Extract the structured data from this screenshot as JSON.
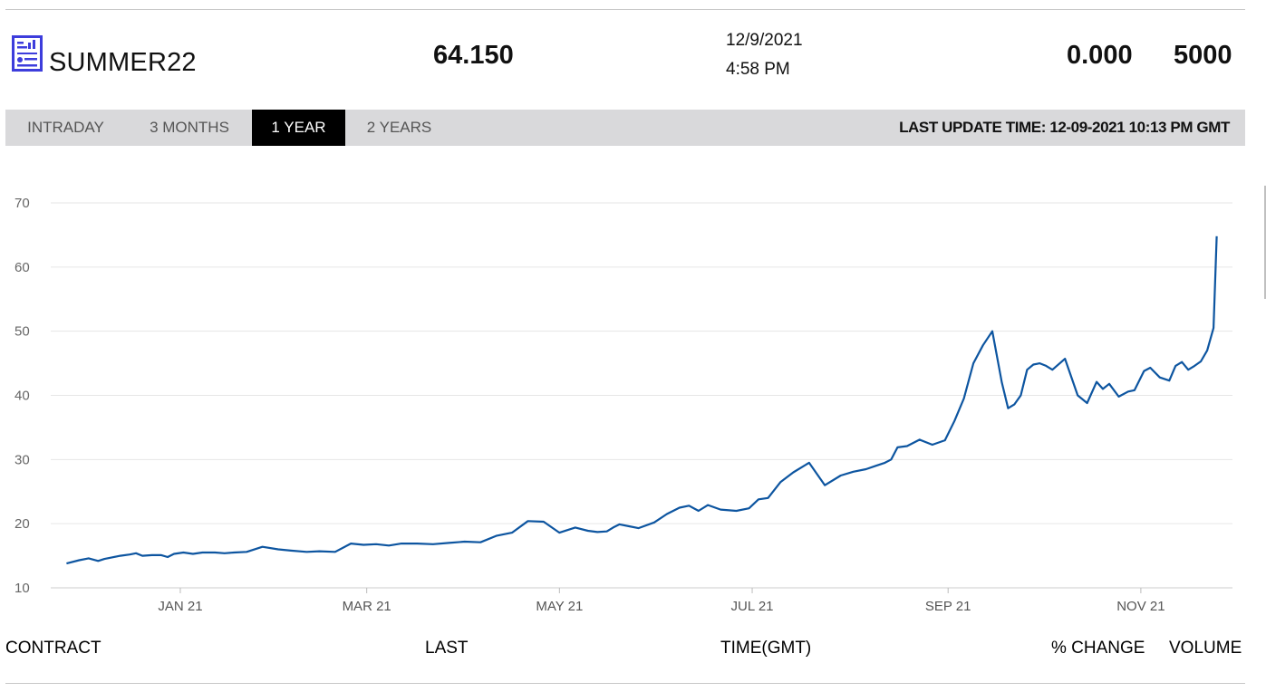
{
  "quote": {
    "contract": "SUMMER22",
    "last": "64.150",
    "date": "12/9/2021",
    "time": "4:58 PM",
    "pct_change": "0.000",
    "volume": "5000"
  },
  "tabs": [
    {
      "label": "INTRADAY",
      "active": false
    },
    {
      "label": "3 MONTHS",
      "active": false
    },
    {
      "label": "1 YEAR",
      "active": true
    },
    {
      "label": "2 YEARS",
      "active": false
    }
  ],
  "last_update": "LAST UPDATE TIME: 12-09-2021 10:13 PM GMT",
  "columns": {
    "contract": "CONTRACT",
    "last": "LAST",
    "time": "TIME(GMT)",
    "pct_change": "% CHANGE",
    "volume": "VOLUME"
  },
  "colors": {
    "line": "#0d55a0",
    "active_tab_bg": "#000000",
    "tabbar_bg": "#d9d9db",
    "icon": "#3d3ddc",
    "grid": "#e6e6e6"
  },
  "icon": "contract-report-icon",
  "chart_data": {
    "type": "line",
    "title": "",
    "xlabel": "",
    "ylabel": "",
    "ylim": [
      10,
      70
    ],
    "yticks": [
      10,
      20,
      30,
      40,
      50,
      60,
      70
    ],
    "xticks": [
      {
        "label": "JAN 21",
        "date": "2021-01-15"
      },
      {
        "label": "MAR 21",
        "date": "2021-03-15"
      },
      {
        "label": "MAY 21",
        "date": "2021-05-15"
      },
      {
        "label": "JUL 21",
        "date": "2021-07-15"
      },
      {
        "label": "SEP 21",
        "date": "2021-09-15"
      },
      {
        "label": "NOV 21",
        "date": "2021-11-15"
      }
    ],
    "grid": "horizontal",
    "legend": "none",
    "series": [
      {
        "x": [
          "2020-12-10",
          "2020-12-14",
          "2020-12-17",
          "2020-12-20",
          "2020-12-22",
          "2020-12-24",
          "2020-12-27",
          "2020-12-30",
          "2021-01-01",
          "2021-01-03",
          "2021-01-06",
          "2021-01-09",
          "2021-01-11",
          "2021-01-13",
          "2021-01-16",
          "2021-01-19",
          "2021-01-22",
          "2021-01-26",
          "2021-01-29",
          "2021-02-01",
          "2021-02-05",
          "2021-02-10",
          "2021-02-15",
          "2021-02-19",
          "2021-02-24",
          "2021-02-28",
          "2021-03-05",
          "2021-03-10",
          "2021-03-14",
          "2021-03-18",
          "2021-03-22",
          "2021-03-26",
          "2021-03-31",
          "2021-04-05",
          "2021-04-10",
          "2021-04-15",
          "2021-04-20",
          "2021-04-25",
          "2021-04-30",
          "2021-05-05",
          "2021-05-10",
          "2021-05-15",
          "2021-05-20",
          "2021-05-24",
          "2021-05-27",
          "2021-05-30",
          "2021-06-01",
          "2021-06-03",
          "2021-06-06",
          "2021-06-09",
          "2021-06-14",
          "2021-06-18",
          "2021-06-22",
          "2021-06-25",
          "2021-06-28",
          "2021-07-01",
          "2021-07-05",
          "2021-07-10",
          "2021-07-14",
          "2021-07-17",
          "2021-07-20",
          "2021-07-24",
          "2021-07-28",
          "2021-08-02",
          "2021-08-07",
          "2021-08-12",
          "2021-08-16",
          "2021-08-20",
          "2021-08-23",
          "2021-08-26",
          "2021-08-28",
          "2021-08-30",
          "2021-09-02",
          "2021-09-06",
          "2021-09-10",
          "2021-09-14",
          "2021-09-17",
          "2021-09-20",
          "2021-09-23",
          "2021-09-26",
          "2021-09-29",
          "2021-10-02",
          "2021-10-04",
          "2021-10-06",
          "2021-10-08",
          "2021-10-10",
          "2021-10-12",
          "2021-10-14",
          "2021-10-16",
          "2021-10-18",
          "2021-10-22",
          "2021-10-26",
          "2021-10-29",
          "2021-11-01",
          "2021-11-03",
          "2021-11-05",
          "2021-11-08",
          "2021-11-11",
          "2021-11-13",
          "2021-11-16",
          "2021-11-18",
          "2021-11-21",
          "2021-11-24",
          "2021-11-26",
          "2021-11-28",
          "2021-11-30",
          "2021-12-02",
          "2021-12-04",
          "2021-12-06",
          "2021-12-08",
          "2021-12-09"
        ],
        "values": [
          13.8,
          14.3,
          14.6,
          14.2,
          14.5,
          14.7,
          15.0,
          15.2,
          15.4,
          15.0,
          15.1,
          15.1,
          14.8,
          15.3,
          15.5,
          15.3,
          15.5,
          15.5,
          15.4,
          15.5,
          15.6,
          16.4,
          16.0,
          15.8,
          15.6,
          15.7,
          15.6,
          16.9,
          16.7,
          16.8,
          16.6,
          16.9,
          16.9,
          16.8,
          17.0,
          17.2,
          17.1,
          18.1,
          18.6,
          20.4,
          20.3,
          18.6,
          19.4,
          18.9,
          18.7,
          18.8,
          19.4,
          19.9,
          19.6,
          19.3,
          20.2,
          21.5,
          22.5,
          22.8,
          22.0,
          22.9,
          22.2,
          22.0,
          22.4,
          23.8,
          24.0,
          26.5,
          28.0,
          29.5,
          26.0,
          27.5,
          28.1,
          28.5,
          29.0,
          29.5,
          30.0,
          31.9,
          32.1,
          33.1,
          32.3,
          33.0,
          36.0,
          39.5,
          45.0,
          47.8,
          50.0,
          42.0,
          38.0,
          38.6,
          40.0,
          44.0,
          44.8,
          45.0,
          44.6,
          44.0,
          45.7,
          40.0,
          38.8,
          42.1,
          41.0,
          41.8,
          39.8,
          40.6,
          40.8,
          43.8,
          44.3,
          42.8,
          42.3,
          44.6,
          45.2,
          44.0,
          44.6,
          45.3,
          47.0,
          50.5,
          64.8
        ]
      }
    ]
  }
}
